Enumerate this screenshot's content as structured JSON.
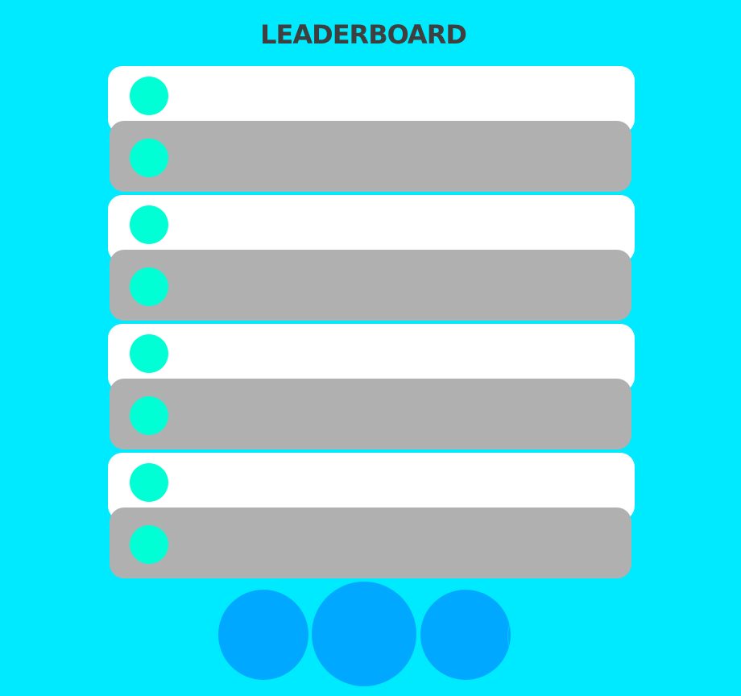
{
  "title": "LEADERBOARD",
  "colors": {
    "background": "#00eaff",
    "row_light": "#ffffff",
    "row_dark": "#b0b0b0",
    "avatar": "#00ffd5",
    "nav_button": "#00a8ff",
    "title_text": "#3f3f3f"
  },
  "leaderboard": {
    "rows": [
      {
        "shade": "light"
      },
      {
        "shade": "dark"
      },
      {
        "shade": "light"
      },
      {
        "shade": "dark"
      },
      {
        "shade": "light"
      },
      {
        "shade": "dark"
      },
      {
        "shade": "light"
      },
      {
        "shade": "dark"
      }
    ]
  },
  "nav": {
    "buttons": [
      {
        "name": "nav-ghost-left-button",
        "visible": false
      },
      {
        "name": "nav-left-button",
        "visible": true
      },
      {
        "name": "nav-center-button",
        "visible": true
      },
      {
        "name": "nav-right-button",
        "visible": true
      },
      {
        "name": "nav-ghost-right-button",
        "visible": false
      }
    ]
  }
}
